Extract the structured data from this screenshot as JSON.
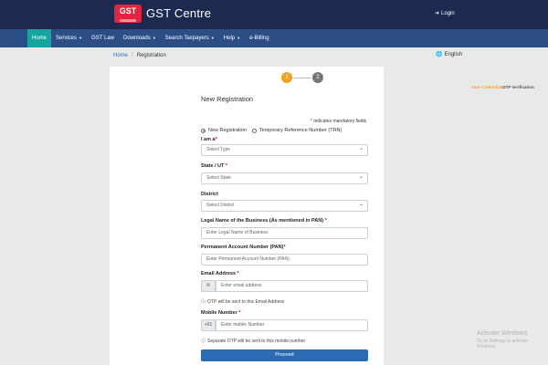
{
  "header": {
    "logo_text": "GST",
    "brand": "GST Centre",
    "login": "Login"
  },
  "nav": {
    "items": [
      {
        "label": "Home",
        "active": true
      },
      {
        "label": "Services",
        "caret": true
      },
      {
        "label": "GST Law"
      },
      {
        "label": "Downloads",
        "caret": true
      },
      {
        "label": "Search Taxpayers",
        "caret": true
      },
      {
        "label": "Help",
        "caret": true
      },
      {
        "label": "e-Billing"
      }
    ]
  },
  "breadcrumb": {
    "home": "Home",
    "current": "Registration"
  },
  "language": "English",
  "stepper": {
    "step1": {
      "number": "1",
      "label": "Your Credentials"
    },
    "step2": {
      "number": "2",
      "label": "OTP Verification"
    }
  },
  "form": {
    "title": "New Registration",
    "mandatory_note": "indicates mandatory fields",
    "radio_new": "New Registration",
    "radio_trn": "Temporary Reference Number (TRN)",
    "iam_label": "I am a",
    "iam_placeholder": "Select Type",
    "state_label": "State / UT",
    "state_placeholder": "Select State",
    "district_label": "District",
    "district_placeholder": "Select District",
    "legal_name_label": "Legal Name of the Business (As mentioned in PAN)",
    "legal_name_placeholder": "Enter Legal Name of Business",
    "pan_label": "Permanent Account Number (PAN)",
    "pan_placeholder": "Enter Permanent Account Number (PAN)",
    "email_label": "Email Address",
    "email_placeholder": "Enter email address",
    "email_hint": "OTP will be sent to this Email Address",
    "mobile_label": "Mobile Number",
    "mobile_prefix": "+91",
    "mobile_placeholder": "Enter mobile Number",
    "mobile_hint": "Separate OTP will be sent to this mobile number",
    "proceed": "Proceed"
  },
  "watermark": {
    "title": "Activate Windows",
    "subtitle": "Go to Settings to activate Windows."
  },
  "colors": {
    "topbar": "#1b2a4e",
    "navbar": "#2c4e86",
    "nav_active": "#16a6a0",
    "accent": "#2c6bb3",
    "step_active": "#f4a11c"
  }
}
